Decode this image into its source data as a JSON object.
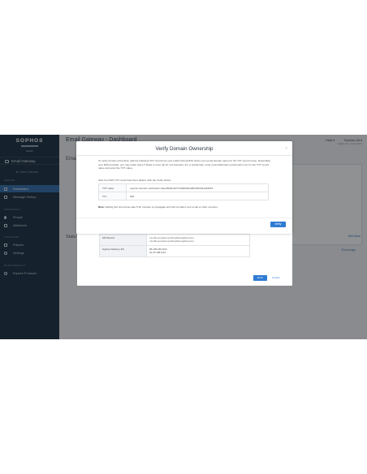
{
  "sidebar": {
    "logo": "SOPHOS",
    "role": "Admin",
    "app": "Email Gateway",
    "switch_link": "Switch Gateway",
    "sections": {
      "analyze": "ANALYZE",
      "configure": "PROTECTION",
      "settings": "CONFIGURE",
      "more": "MORE PRODUCTS"
    },
    "items": [
      {
        "label": "Dashboard",
        "icon": "dashboard-icon",
        "active": true
      },
      {
        "label": "Message History",
        "icon": "message-history-icon",
        "active": false
      },
      {
        "label": "People",
        "icon": "people-icon",
        "active": false
      },
      {
        "label": "Mailboxes",
        "icon": "mailboxes-icon",
        "active": false
      },
      {
        "label": "Policies",
        "icon": "policies-icon",
        "active": false
      },
      {
        "label": "Settings",
        "icon": "gear-icon",
        "active": false
      },
      {
        "label": "Explore Products",
        "icon": "explore-icon",
        "active": false
      }
    ]
  },
  "header": {
    "title": "Email Gateway - Dashboard",
    "help": "Help ▾",
    "user": "Sophos Ltd ▾",
    "user_sub": "Sophos Ltd · Super Admin"
  },
  "main": {
    "section1": "Emai",
    "section2": "Statu",
    "see_more": "See More",
    "time_ago": "8 hours ago"
  },
  "modal": {
    "title": "Verify Domain Ownership",
    "close": "×",
    "instructions": "To verify domain ownership, add the following TXT record into your public facing DNS. Enter your email domain name for the TXT record name. Depending your DNS provider, you may either leave it blank or enter @ for root domains. For a subdomain, enter yoursubdomain.yourdomain.com for the TXT record name and enter the TXT value.",
    "after": "After the DNS TXT record has been added, click the Verify button.",
    "records": [
      {
        "label": "TXT value",
        "value": "sophos-domain-verification=9ae2f6d5e4f27c5b984b8e98b42f03fa4e83615"
      },
      {
        "label": "TTL",
        "value": "600"
      }
    ],
    "note_label": "Note:",
    "note_text": "Adding this record can take 5-10 minutes to propagate and will not affect your email or other services.",
    "verify_label": "Verify"
  },
  "modal2": {
    "note": "Add the following records to your DNS to configure your mail flow.",
    "rows": [
      {
        "label": "MX Record",
        "value1": "mx-01-eu-west-1.prod.hydra.sophos.com",
        "value2": "mx-02-eu-west-1.prod.hydra.sophos.com"
      },
      {
        "label": "Sophos Delivery IPs",
        "value1": "85.208.189.0/24",
        "value2": "91.25.188.0/24"
      }
    ],
    "done_label": "Done",
    "cancel_label": "Cancel"
  }
}
